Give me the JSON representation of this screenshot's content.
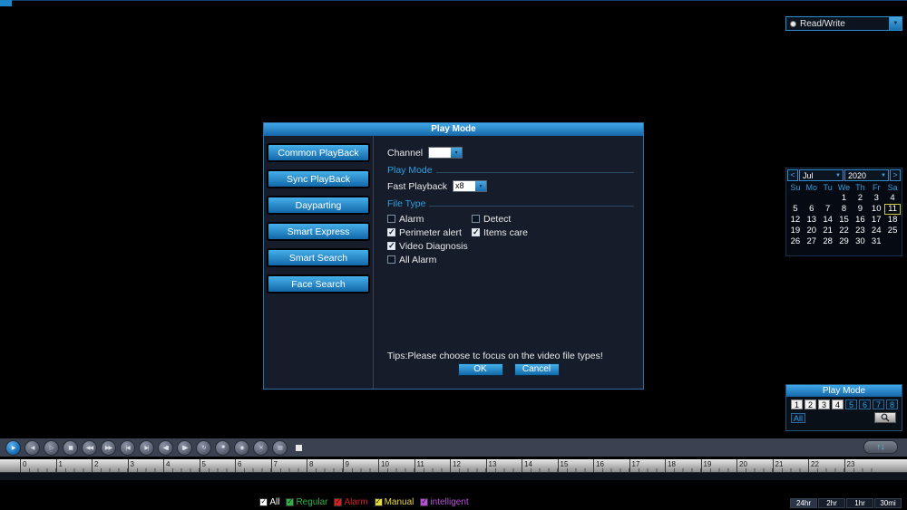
{
  "top_bar": {
    "read_write_label": "Read/Write"
  },
  "dialog": {
    "title": "Play Mode",
    "sidebar_buttons": [
      "Common PlayBack",
      "Sync PlayBack",
      "Dayparting",
      "Smart Express",
      "Smart Search",
      "Face Search"
    ],
    "channel_label": "Channel",
    "channel_value": "",
    "play_mode_section_label": "Play Mode",
    "fast_playback_label": "Fast Playback",
    "fast_playback_value": "x8",
    "file_type_section_label": "File Type",
    "file_type_rows": [
      [
        {
          "label": "Alarm",
          "checked": false
        },
        {
          "label": "Detect",
          "checked": false
        }
      ],
      [
        {
          "label": "Perimeter alert",
          "checked": true
        },
        {
          "label": "Items care",
          "checked": true
        }
      ],
      [
        {
          "label": "Video Diagnosis",
          "checked": true
        }
      ],
      [
        {
          "label": "All Alarm",
          "checked": false
        }
      ]
    ],
    "tips": "Tips:Please choose tc focus on the video file types!",
    "ok_label": "OK",
    "cancel_label": "Cancel"
  },
  "calendar": {
    "prev_label": "<",
    "next_label": ">",
    "month": "Jul",
    "year": "2020",
    "day_names": [
      "Su",
      "Mo",
      "Tu",
      "We",
      "Th",
      "Fr",
      "Sa"
    ],
    "weeks": [
      [
        "",
        "",
        "",
        "1",
        "2",
        "3",
        "4"
      ],
      [
        "5",
        "6",
        "7",
        "8",
        "9",
        "10",
        "11"
      ],
      [
        "12",
        "13",
        "14",
        "15",
        "16",
        "17",
        "18"
      ],
      [
        "19",
        "20",
        "21",
        "22",
        "23",
        "24",
        "25"
      ],
      [
        "26",
        "27",
        "28",
        "29",
        "30",
        "31",
        ""
      ]
    ],
    "selected_date": "11"
  },
  "channel_panel": {
    "title": "Play Mode",
    "channels": [
      {
        "label": "1",
        "active": true
      },
      {
        "label": "2",
        "active": true
      },
      {
        "label": "3",
        "active": true
      },
      {
        "label": "4",
        "active": true
      },
      {
        "label": "5",
        "active": false
      },
      {
        "label": "6",
        "active": false
      },
      {
        "label": "7",
        "active": false
      },
      {
        "label": "8",
        "active": false
      }
    ],
    "all_label": "All"
  },
  "control_bar": {
    "buttons": [
      {
        "name": "play-button",
        "glyph": "▶",
        "primary": true
      },
      {
        "name": "reverse-play-button",
        "glyph": "◀",
        "primary": false
      },
      {
        "name": "slow-play-button",
        "glyph": "▷",
        "primary": false
      },
      {
        "name": "pause-button",
        "glyph": "▮▮",
        "primary": false
      },
      {
        "name": "rewind-button",
        "glyph": "◀◀",
        "primary": false
      },
      {
        "name": "fast-forward-button",
        "glyph": "▶▶",
        "primary": false
      },
      {
        "name": "prev-file-button",
        "glyph": "|◀",
        "primary": false
      },
      {
        "name": "next-file-button",
        "glyph": "▶|",
        "primary": false
      },
      {
        "name": "prev-frame-button",
        "glyph": "◀▮",
        "primary": false
      },
      {
        "name": "next-frame-button",
        "glyph": "▮▶",
        "primary": false
      },
      {
        "name": "loop-button",
        "glyph": "↻",
        "primary": false
      },
      {
        "name": "stop-button",
        "glyph": "■",
        "primary": false
      },
      {
        "name": "snapshot-button",
        "glyph": "◉",
        "primary": false
      },
      {
        "name": "clip-button",
        "glyph": "✕",
        "primary": false
      },
      {
        "name": "backup-button",
        "glyph": "▤",
        "primary": false
      }
    ],
    "toggle_glyph": "↑↓"
  },
  "timeline": {
    "hours": [
      "0",
      "1",
      "2",
      "3",
      "4",
      "5",
      "6",
      "7",
      "8",
      "9",
      "10",
      "11",
      "12",
      "13",
      "14",
      "15",
      "16",
      "17",
      "18",
      "19",
      "20",
      "21",
      "22",
      "23"
    ]
  },
  "legend": [
    {
      "label": "All",
      "color": "#ffffff"
    },
    {
      "label": "Regular",
      "color": "#2fb344"
    },
    {
      "label": "Alarm",
      "color": "#d81e1e"
    },
    {
      "label": "Manual",
      "color": "#e8d93c"
    },
    {
      "label": "intelligent",
      "color": "#b94fd6"
    }
  ],
  "time_ranges": [
    {
      "label": "24hr",
      "active": true
    },
    {
      "label": "2hr",
      "active": false
    },
    {
      "label": "1hr",
      "active": false
    },
    {
      "label": "30mi",
      "active": false
    }
  ]
}
